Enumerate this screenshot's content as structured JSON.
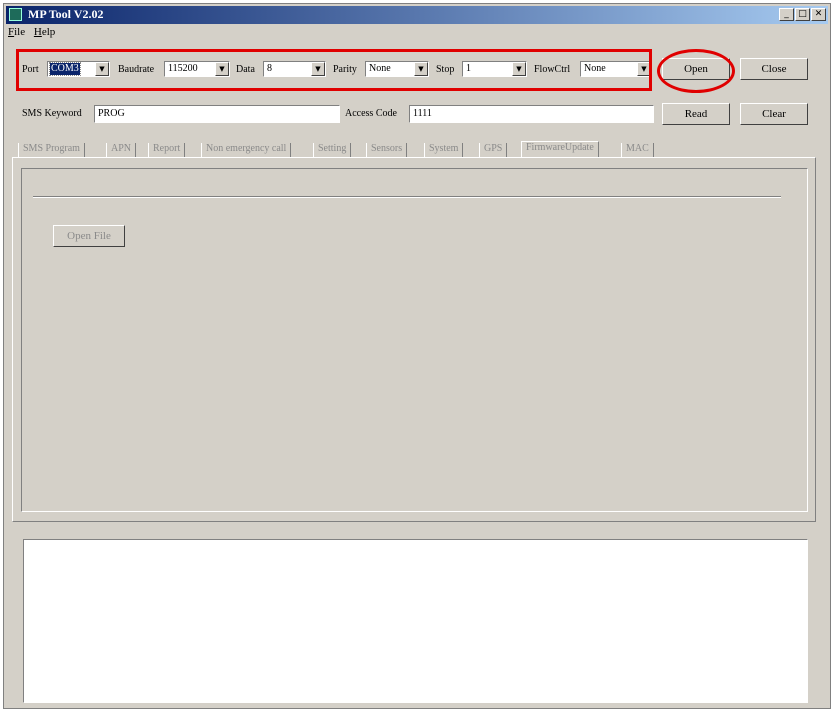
{
  "window": {
    "title": "MP Tool V2.02",
    "minimize": "_",
    "maximize": "□",
    "close": "✕"
  },
  "menu": {
    "items": [
      "File",
      "Help"
    ]
  },
  "serial": {
    "port_label": "Port",
    "port_value": "COM3",
    "baudrate_label": "Baudrate",
    "baudrate_value": "115200",
    "data_label": "Data",
    "data_value": "8",
    "parity_label": "Parity",
    "parity_value": "None",
    "stop_label": "Stop",
    "stop_value": "1",
    "flowctrl_label": "FlowCtrl",
    "flowctrl_value": "None"
  },
  "buttons": {
    "open": "Open",
    "close": "Close",
    "read": "Read",
    "clear": "Clear",
    "open_file": "Open File"
  },
  "sms": {
    "keyword_label": "SMS Keyword",
    "keyword_value": "PROG",
    "access_label": "Access Code",
    "access_value": "1111"
  },
  "tabs": [
    "SMS Program",
    "APN",
    "Report",
    "Non emergency call",
    "Setting",
    "Sensors",
    "System",
    "GPS",
    "FirmwareUpdate",
    "MAC"
  ],
  "active_tab": "FirmwareUpdate",
  "colors": {
    "highlight": "#e00000",
    "titlebar": "#0a246a",
    "face": "#d4d0c8"
  }
}
